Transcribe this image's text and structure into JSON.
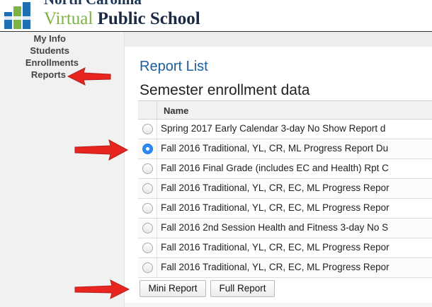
{
  "header": {
    "org_line": "North Carolina",
    "brand_virtual": "Virtual",
    "brand_public": "Public School"
  },
  "sidebar": {
    "items": [
      {
        "label": "My Info"
      },
      {
        "label": "Students"
      },
      {
        "label": "Enrollments"
      },
      {
        "label": "Reports"
      }
    ]
  },
  "main": {
    "title": "Report List",
    "section_title": "Semester enrollment data",
    "table": {
      "column_name": "Name",
      "rows": [
        {
          "name": "Spring 2017 Early Calendar 3-day No Show Report d",
          "selected": false
        },
        {
          "name": "Fall 2016 Traditional, YL, CR, ML Progress Report Du",
          "selected": true
        },
        {
          "name": "Fall 2016 Final Grade (includes EC and Health) Rpt C",
          "selected": false
        },
        {
          "name": "Fall 2016 Traditional, YL, CR, EC, ML Progress Repor",
          "selected": false
        },
        {
          "name": "Fall 2016 Traditional, YL, CR, EC, ML Progress Repor",
          "selected": false
        },
        {
          "name": "Fall 2016 2nd Session Health and Fitness 3-day No S",
          "selected": false
        },
        {
          "name": "Fall 2016 Traditional, YL, CR, EC, ML Progress Repor",
          "selected": false
        },
        {
          "name": "Fall 2016 Traditional, YL, CR, EC, ML Progress Repor",
          "selected": false
        }
      ]
    },
    "buttons": {
      "mini_report": "Mini Report",
      "full_report": "Full Report"
    }
  },
  "colors": {
    "accent_blue": "#1b5e9c",
    "brand_green": "#7cb342",
    "brand_navy": "#1a2a44",
    "annotation_red": "#e8251e",
    "radio_selected": "#2a8cf0"
  },
  "icons": {
    "logo": "nc-virtual-logo-bars",
    "annotation": "red-arrow-icon",
    "radio": "radio-button-icon"
  }
}
